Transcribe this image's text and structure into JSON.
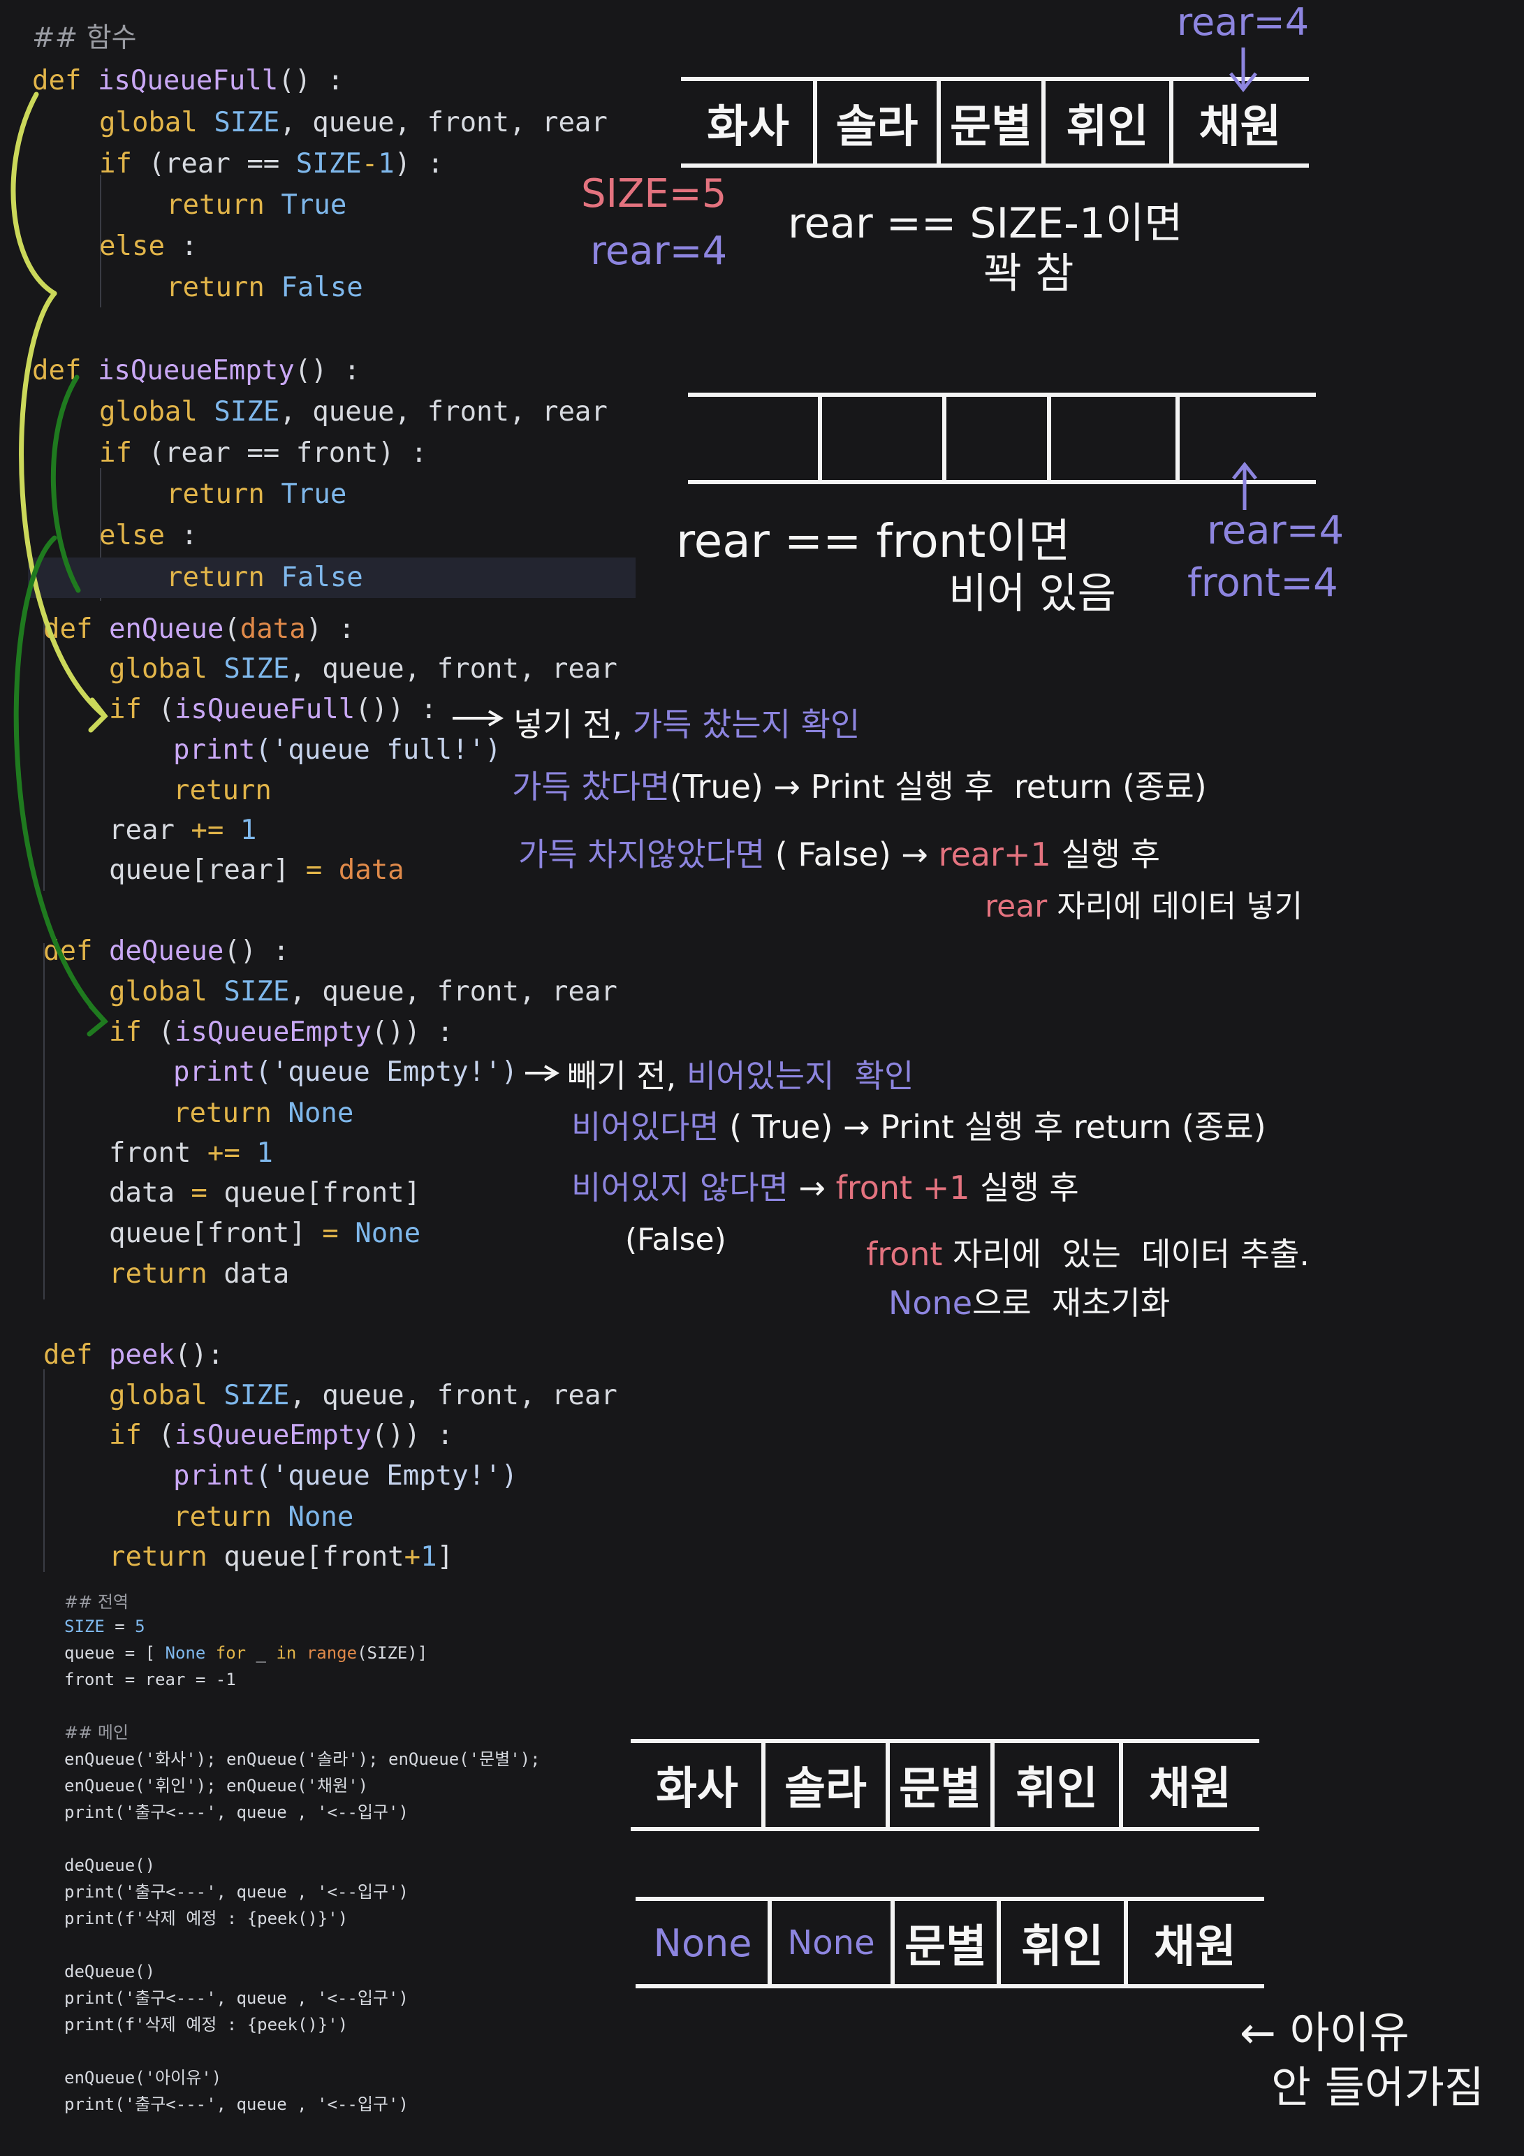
{
  "code": {
    "functions_header": "## 함수",
    "is_full": {
      "def_kw": "def",
      "name": "isQueueFull",
      "sig": "() :",
      "g_kw": "global",
      "g_size": "SIZE",
      "g_rest": ", queue, front, rear",
      "if_kw": "if",
      "cond_a": " (rear == ",
      "cond_size": "SIZE",
      "cond_b": "-",
      "cond_one": "1",
      "cond_c": ") :",
      "ret_kw": "return",
      "ret_true": "True",
      "else_kw": "else",
      "else_rest": " :",
      "ret_false": "False"
    },
    "is_empty": {
      "def_kw": "def",
      "name": "isQueueEmpty",
      "sig": "() :",
      "g_kw": "global",
      "g_size": "SIZE",
      "g_rest": ", queue, front, rear",
      "if_kw": "if",
      "cond": " (rear == front) :",
      "ret_kw": "return",
      "ret_true": "True",
      "else_kw": "else",
      "else_rest": " :",
      "ret_false": "False"
    },
    "enqueue": {
      "def_kw": "def",
      "name": "enQueue",
      "param_open": "(",
      "param": "data",
      "param_close": ") :",
      "g_kw": "global",
      "g_size": "SIZE",
      "g_rest": ", queue, front, rear",
      "if_kw": "if",
      "cond_a": " (",
      "cond_fn": "isQueueFull",
      "cond_b": "()) :",
      "print_fn": "print",
      "print_arg": "('queue full!')",
      "ret_kw": "return",
      "inc_a": "rear ",
      "inc_op": "+=",
      "inc_b": " ",
      "inc_num": "1",
      "assign_a": "queue[rear] ",
      "assign_op": "=",
      "assign_b": " ",
      "assign_val": "data"
    },
    "dequeue": {
      "def_kw": "def",
      "name": "deQueue",
      "sig": "() :",
      "g_kw": "global",
      "g_size": "SIZE",
      "g_rest": ", queue, front, rear",
      "if_kw": "if",
      "cond_a": " (",
      "cond_fn": "isQueueEmpty",
      "cond_b": "()) :",
      "print_fn": "print",
      "print_arg": "('queue Empty!')",
      "ret_kw": "return",
      "ret_none": "None",
      "inc_a": "front ",
      "inc_op": "+=",
      "inc_b": " ",
      "inc_num": "1",
      "data_a": "data ",
      "data_op": "=",
      "data_b": " queue[front]",
      "qf_a": "queue[front] ",
      "qf_op": "=",
      "qf_b": " ",
      "qf_none": "None",
      "ret_data": " data"
    },
    "peek": {
      "def_kw": "def",
      "name": "peek",
      "sig": "():",
      "g_kw": "global",
      "g_size": "SIZE",
      "g_rest": ", queue, front, rear",
      "if_kw": "if",
      "cond_a": " (",
      "cond_fn": "isQueueEmpty",
      "cond_b": "()) :",
      "print_fn": "print",
      "print_arg": "('queue Empty!')",
      "ret_kw": "return",
      "ret_none": "None",
      "ret_expr_a": " queue[front",
      "ret_plus": "+",
      "ret_one": "1",
      "ret_expr_b": "]"
    },
    "globals": {
      "header": "## 전역",
      "size_a": "SIZE",
      "size_b": " = ",
      "size_val": "5",
      "queue_a": "queue = [ ",
      "queue_none": "None",
      "queue_for": " for",
      " queue_us": "",
      "queue_mid": " _ ",
      "queue_in": "in",
      "queue_sp": " ",
      "queue_range": "range",
      "queue_arg": "(SIZE)]",
      "front": "front = rear = -1"
    },
    "main": {
      "header": "## 메인",
      "l1": "enQueue('화사'); enQueue('솔라'); enQueue('문별');",
      "l2": "enQueue('휘인'); enQueue('채원')",
      "l3": "print('출구<---', queue , '<--입구')",
      "l4": "deQueue()",
      "l5": "print('출구<---', queue , '<--입구')",
      "l6": "print(f'삭제 예정 : {peek()}')",
      "l7": "deQueue()",
      "l8": "print('출구<---', queue , '<--입구')",
      "l9": "print(f'삭제 예정 : {peek()}')",
      "l10": "enQueue('아이유')",
      "l11": "print('출구<---', queue , '<--입구')"
    }
  },
  "notes": {
    "full": {
      "rear_top": "rear=4",
      "cells": [
        "화사",
        "솔라",
        "문별",
        "휘인",
        "채원"
      ],
      "size": "SIZE=5",
      "rear": "rear=4",
      "line1": "rear == SIZE-1이면",
      "line2": "꽉 참"
    },
    "empty": {
      "line1": "rear == front이면",
      "line2": "비어 있음",
      "rear": "rear=4",
      "front": "front=4"
    },
    "enqueue": {
      "l1_white": "넣기 전, ",
      "l1_purple": "가득 찼는지 확인",
      "l2_purple": "가득 찼다면",
      "l2_white": "(True) → Print 실행 후  return (종료)",
      "l3_purple": "가득 차지않았다면",
      "l3_white": " ( False) → ",
      "l3_red": "rear+1",
      "l3_white2": " 실행 후",
      "l4_red": "rear",
      "l4_white": " 자리에 데이터 넣기"
    },
    "dequeue": {
      "l1_white": "빼기 전, ",
      "l1_purple": "비어있는지  확인",
      "l2_purple": "비어있다면",
      "l2_white": " ( True) → Print 실행 후 return (종료)",
      "l3_purple": "비어있지 않다면",
      "l3_white": " → ",
      "l3_red": "front +1",
      "l3_white2": " 실행 후",
      "l4_white": "(False)",
      "l5_red": "front",
      "l5_white": " 자리에  있는  데이터 추출.",
      "l6_purple": "None",
      "l6_white": "으로  재초기화"
    },
    "result": {
      "row1": [
        "화사",
        "솔라",
        "문별",
        "휘인",
        "채원"
      ],
      "row2": [
        "None",
        "None",
        "문별",
        "휘인",
        "채원"
      ],
      "iu_line1": "← 아이유",
      "iu_line2": "안 들어가짐"
    }
  },
  "colors": {
    "background": "#171719",
    "keyword": "#e2b54a",
    "function": "#c9a8f5",
    "builtin": "#7fb8ec",
    "handwriting_purple": "#8d85df",
    "handwriting_red": "#e4737f",
    "bracket_yellow": "#cbd85a",
    "bracket_green": "#1f7a1f"
  }
}
